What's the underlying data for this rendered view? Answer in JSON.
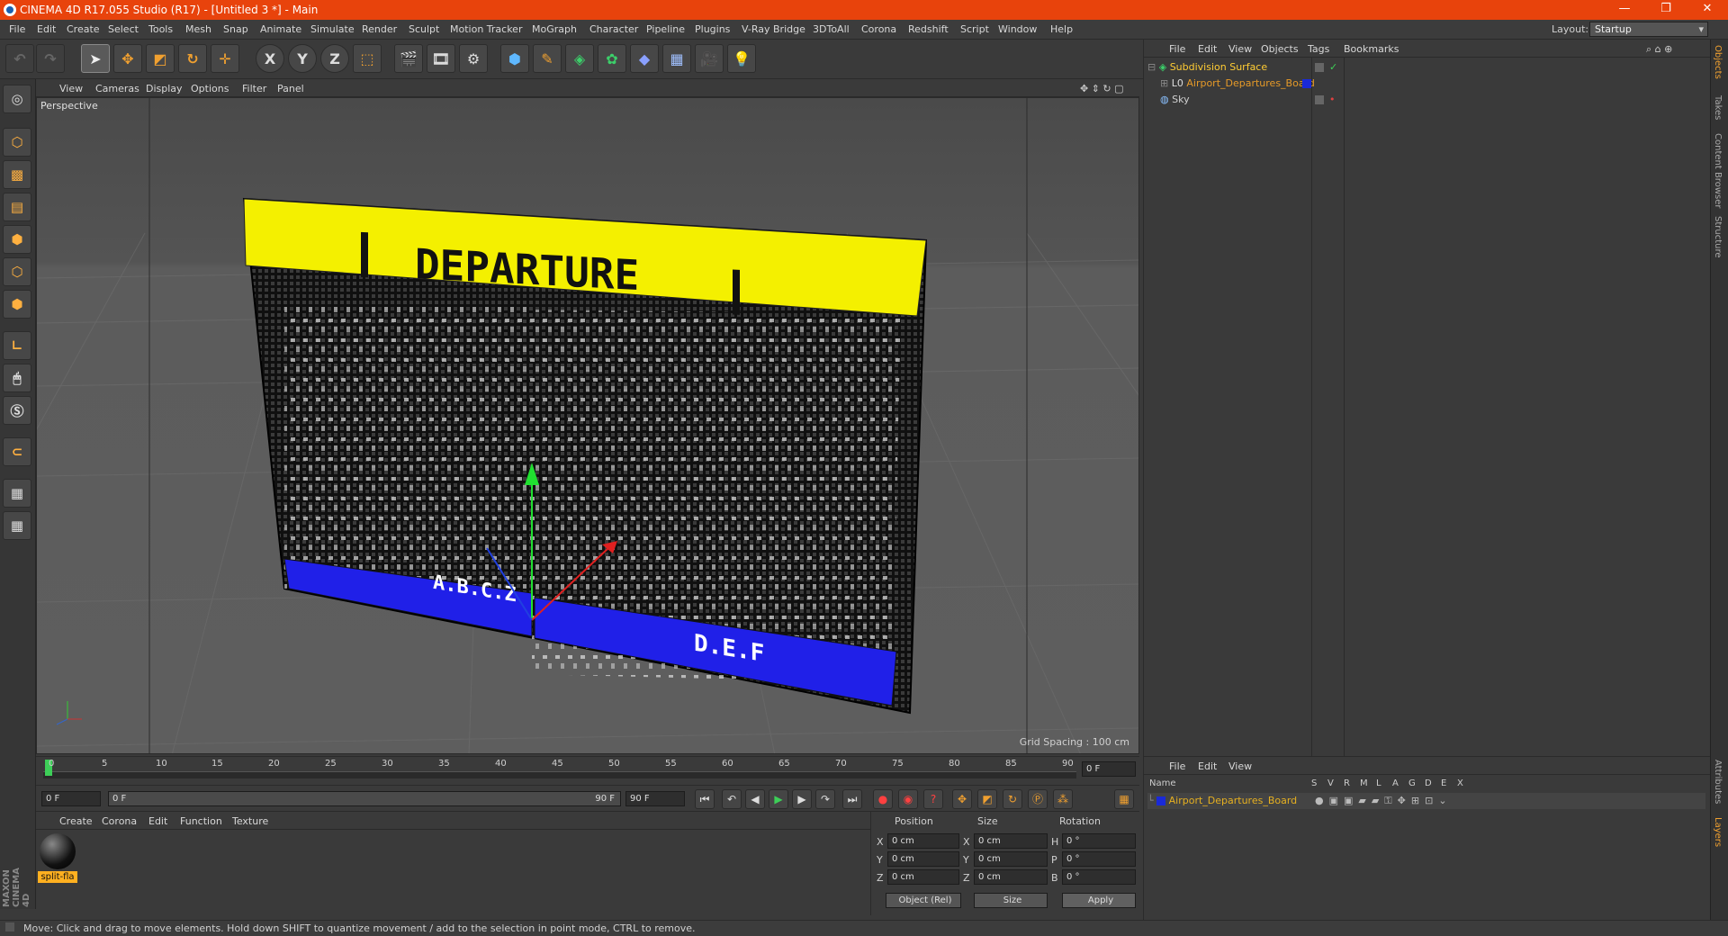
{
  "window": {
    "title": "CINEMA 4D R17.055 Studio (R17) - [Untitled 3 *] - Main",
    "buttons": [
      "—",
      "❐",
      "✕"
    ]
  },
  "menu": {
    "items": [
      "File",
      "Edit",
      "Create",
      "Select",
      "Tools",
      "Mesh",
      "Snap",
      "Animate",
      "Simulate",
      "Render",
      "Sculpt",
      "Motion Tracker",
      "MoGraph",
      "Character",
      "Pipeline",
      "Plugins",
      "V-Ray Bridge",
      "3DToAll",
      "Corona",
      "Redshift",
      "Script",
      "Window",
      "Help"
    ],
    "layout_label": "Layout:",
    "layout_value": "Startup"
  },
  "toolbar": {
    "axis": [
      "X",
      "Y",
      "Z"
    ]
  },
  "viewport": {
    "menu": [
      "View",
      "Cameras",
      "Display",
      "Options",
      "Filter",
      "Panel"
    ],
    "label": "Perspective",
    "grid_spacing": "Grid Spacing : 100 cm",
    "board": {
      "header": "DEPARTURE",
      "left_panel": "A.B.C.Z",
      "right_panel": "D.E.F"
    }
  },
  "timeline": {
    "ticks": [
      "0",
      "5",
      "10",
      "15",
      "20",
      "25",
      "30",
      "35",
      "40",
      "45",
      "50",
      "55",
      "60",
      "65",
      "70",
      "75",
      "80",
      "85",
      "90"
    ],
    "current_frame": "0 F"
  },
  "transport": {
    "start": "0 F",
    "range_start": "0 F",
    "range_end": "90 F",
    "end": "90 F"
  },
  "material": {
    "menu": [
      "Create",
      "Corona",
      "Edit",
      "Function",
      "Texture"
    ],
    "name": "split-fla"
  },
  "coords": {
    "headers": [
      "Position",
      "Size",
      "Rotation"
    ],
    "rows": [
      {
        "pl": "X",
        "pv": "0 cm",
        "sl": "X",
        "sv": "0 cm",
        "rl": "H",
        "rv": "0 °"
      },
      {
        "pl": "Y",
        "pv": "0 cm",
        "sl": "Y",
        "sv": "0 cm",
        "rl": "P",
        "rv": "0 °"
      },
      {
        "pl": "Z",
        "pv": "0 cm",
        "sl": "Z",
        "sv": "0 cm",
        "rl": "B",
        "rv": "0 °"
      }
    ],
    "mode": "Object (Rel)",
    "size_mode": "Size",
    "apply": "Apply"
  },
  "objects": {
    "menu": [
      "File",
      "Edit",
      "View",
      "Objects",
      "Tags",
      "Bookmarks"
    ],
    "items": [
      {
        "name": "Subdivision Surface",
        "color": "#ffcc33"
      },
      {
        "name": "Airport_Departures_Board",
        "color": "#e69a28"
      },
      {
        "name": "Sky",
        "color": "#d0d0d0"
      }
    ]
  },
  "layers": {
    "menu": [
      "File",
      "Edit",
      "View"
    ],
    "columns": [
      "Name",
      "S",
      "V",
      "R",
      "M",
      "L",
      "A",
      "G",
      "D",
      "E",
      "X"
    ],
    "items": [
      {
        "name": "Airport_Departures_Board",
        "color": "#1a2ad8"
      }
    ]
  },
  "righttabs": [
    "Objects",
    "Takes",
    "Content Browser",
    "Structure",
    "Attributes",
    "Layers"
  ],
  "brand": "MAXON CINEMA 4D",
  "status": "Move: Click and drag to move elements. Hold down SHIFT to quantize movement / add to the selection in point mode, CTRL to remove."
}
